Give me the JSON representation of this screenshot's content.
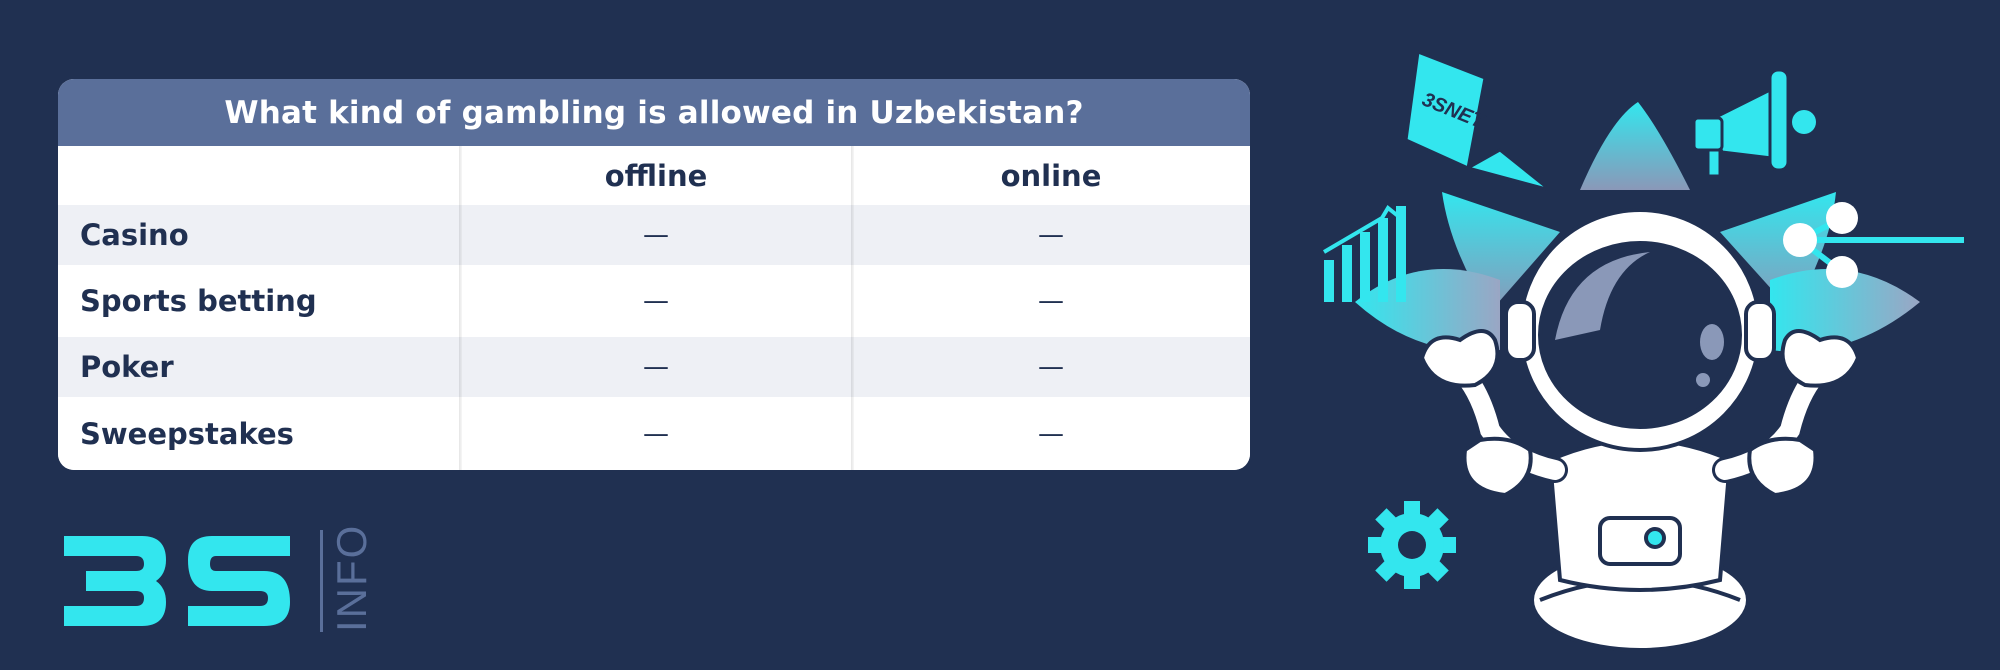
{
  "table": {
    "title": "What kind of gambling is allowed in Uzbekistan?",
    "columns": [
      "",
      "offline",
      "online"
    ],
    "rows": [
      {
        "label": "Casino",
        "offline": "—",
        "online": "—"
      },
      {
        "label": "Sports betting",
        "offline": "—",
        "online": "—"
      },
      {
        "label": "Poker",
        "offline": "—",
        "online": "—"
      },
      {
        "label": "Sweepstakes",
        "offline": "—",
        "online": "—"
      }
    ]
  },
  "logo": {
    "mark": "3S",
    "sub": "INFO"
  },
  "illustration": {
    "badge_text": "3SNET",
    "icons": [
      "bar-chart-icon",
      "megaphone-icon",
      "share-icon",
      "gear-icon",
      "laptop-icon"
    ]
  },
  "colors": {
    "background": "#203051",
    "title_bar": "#5a6f9a",
    "accent": "#33e6ee",
    "row_alt": "#eef0f5",
    "text": "#203051"
  }
}
